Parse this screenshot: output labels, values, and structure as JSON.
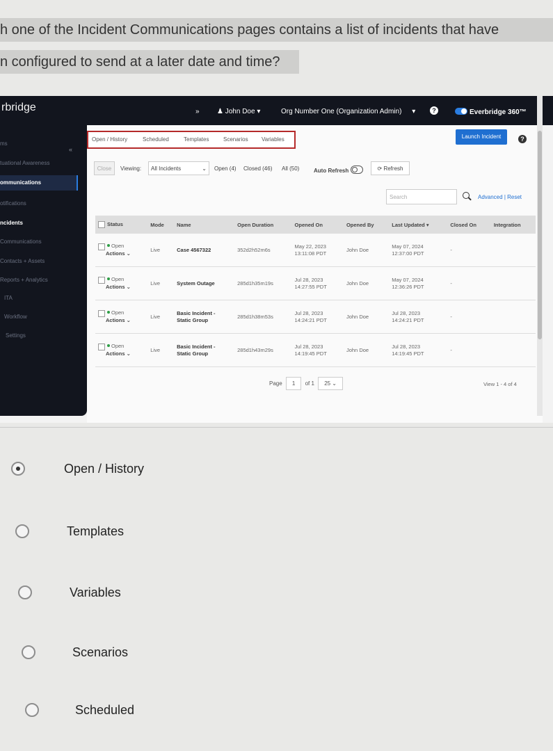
{
  "question": {
    "line1": "h one of the Incident Communications pages contains a list of incidents that have",
    "line2": "n configured to send at a later date and time?"
  },
  "app": {
    "brand": "rbridge",
    "topbar": {
      "expand": "»",
      "user": "John Doe ▾",
      "org": "Org Number One (Organization Admin)",
      "org_chevron": "▾",
      "help": "?",
      "product": "Everbridge 360™"
    },
    "sidebar": {
      "items": [
        {
          "label": "ms"
        },
        {
          "label": "tuational Awareness"
        },
        {
          "label": "ommunications"
        },
        {
          "label": "otifications"
        },
        {
          "label": "ncidents"
        },
        {
          "label": "Communications"
        },
        {
          "label": "Contacts + Assets"
        },
        {
          "label": "Reports + Analytics"
        },
        {
          "label": "ITA"
        },
        {
          "label": "Workflow"
        },
        {
          "label": "Settings"
        }
      ],
      "collapse": "«"
    },
    "tabs": [
      "Open / History",
      "Scheduled",
      "Templates",
      "Scenarios",
      "Variables"
    ],
    "launch_button": "Launch Incident",
    "help2": "?",
    "filters": {
      "close": "Close",
      "viewing_label": "Viewing:",
      "viewing_value": "All Incidents",
      "viewing_chevron": "⌄",
      "open": "Open (4)",
      "closed": "Closed (46)",
      "all": "All (50)",
      "auto_refresh": "Auto Refresh",
      "refresh": "⟳ Refresh"
    },
    "search": {
      "placeholder": "Search",
      "advanced": "Advanced",
      "reset": "| Reset"
    },
    "table": {
      "headers": [
        "Status",
        "Mode",
        "Name",
        "Open Duration",
        "Opened On",
        "Opened By",
        "Last Updated ▾",
        "Closed On",
        "Integration"
      ],
      "rows": [
        {
          "status": "Open",
          "actions": "Actions ⌄",
          "mode": "Live",
          "name1": "Case 4567322",
          "name2": "",
          "duration": "352d2h52m6s",
          "opened1": "May 22, 2023",
          "opened2": "13:11:08 PDT",
          "by": "John Doe",
          "updated1": "May 07, 2024",
          "updated2": "12:37:00 PDT",
          "closed": "-"
        },
        {
          "status": "Open",
          "actions": "Actions ⌄",
          "mode": "Live",
          "name1": "System Outage",
          "name2": "",
          "duration": "285d1h35m19s",
          "opened1": "Jul 28, 2023",
          "opened2": "14:27:55 PDT",
          "by": "John Doe",
          "updated1": "May 07, 2024",
          "updated2": "12:36:26 PDT",
          "closed": "-"
        },
        {
          "status": "Open",
          "actions": "Actions ⌄",
          "mode": "Live",
          "name1": "Basic Incident -",
          "name2": "Static Group",
          "duration": "285d1h38m53s",
          "opened1": "Jul 28, 2023",
          "opened2": "14:24:21 PDT",
          "by": "John Doe",
          "updated1": "Jul 28, 2023",
          "updated2": "14:24:21 PDT",
          "closed": "-"
        },
        {
          "status": "Open",
          "actions": "Actions ⌄",
          "mode": "Live",
          "name1": "Basic Incident -",
          "name2": "Static Group",
          "duration": "285d1h43m29s",
          "opened1": "Jul 28, 2023",
          "opened2": "14:19:45 PDT",
          "by": "John Doe",
          "updated1": "Jul 28, 2023",
          "updated2": "14:19:45 PDT",
          "closed": "-"
        }
      ]
    },
    "pager": {
      "page_label": "Page",
      "page": "1",
      "of": "of 1",
      "size": "25 ⌄",
      "view": "View 1 - 4 of 4"
    }
  },
  "options": [
    {
      "label": "Open / History",
      "selected": true
    },
    {
      "label": "Templates",
      "selected": false
    },
    {
      "label": "Variables",
      "selected": false
    },
    {
      "label": "Scenarios",
      "selected": false
    },
    {
      "label": "Scheduled",
      "selected": false
    }
  ]
}
